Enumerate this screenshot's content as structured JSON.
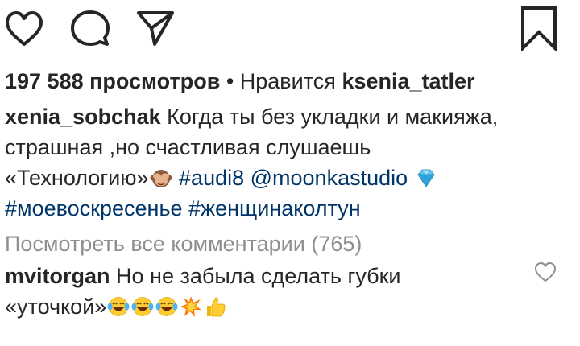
{
  "actions": {
    "like_icon": "heart-outline-icon",
    "comment_icon": "speech-bubble-icon",
    "share_icon": "paper-plane-icon",
    "save_icon": "bookmark-icon"
  },
  "stats": {
    "views": "197 588 просмотров",
    "separator": " • ",
    "liked_by_prefix": "Нравится ",
    "liked_by_user": "ksenia_tatler"
  },
  "caption": {
    "username": "xenia_sobchak",
    "line1_text": " Когда ты без укладки и макияжа,",
    "line2_text": "страшная ,но счастливая слушаешь",
    "line3_text": "«Технологию»",
    "line3_emoji": "see-no-evil-monkey-emoji",
    "line3_tag": " #audi8",
    "line3_mention": " @moonkastudio ",
    "line3_emoji_end": "gem-stone-emoji",
    "line4_tag1": "#моевоскресенье",
    "line4_tag2": " #женщинаколтун"
  },
  "view_all_comments": "Посмотреть все комментарии (765)",
  "comment": {
    "username": "mvitorgan",
    "line1_text": " Но не забыла сделать губки",
    "line2_text": "«уточкой»",
    "emojis": [
      "tears-of-joy-emoji",
      "tears-of-joy-emoji",
      "tears-of-joy-emoji",
      "collision-emoji",
      "thumbs-up-emoji"
    ],
    "like_icon": "small-heart-outline-icon"
  },
  "colors": {
    "text": "#262626",
    "link": "#003569",
    "muted": "#8e8e8e"
  }
}
